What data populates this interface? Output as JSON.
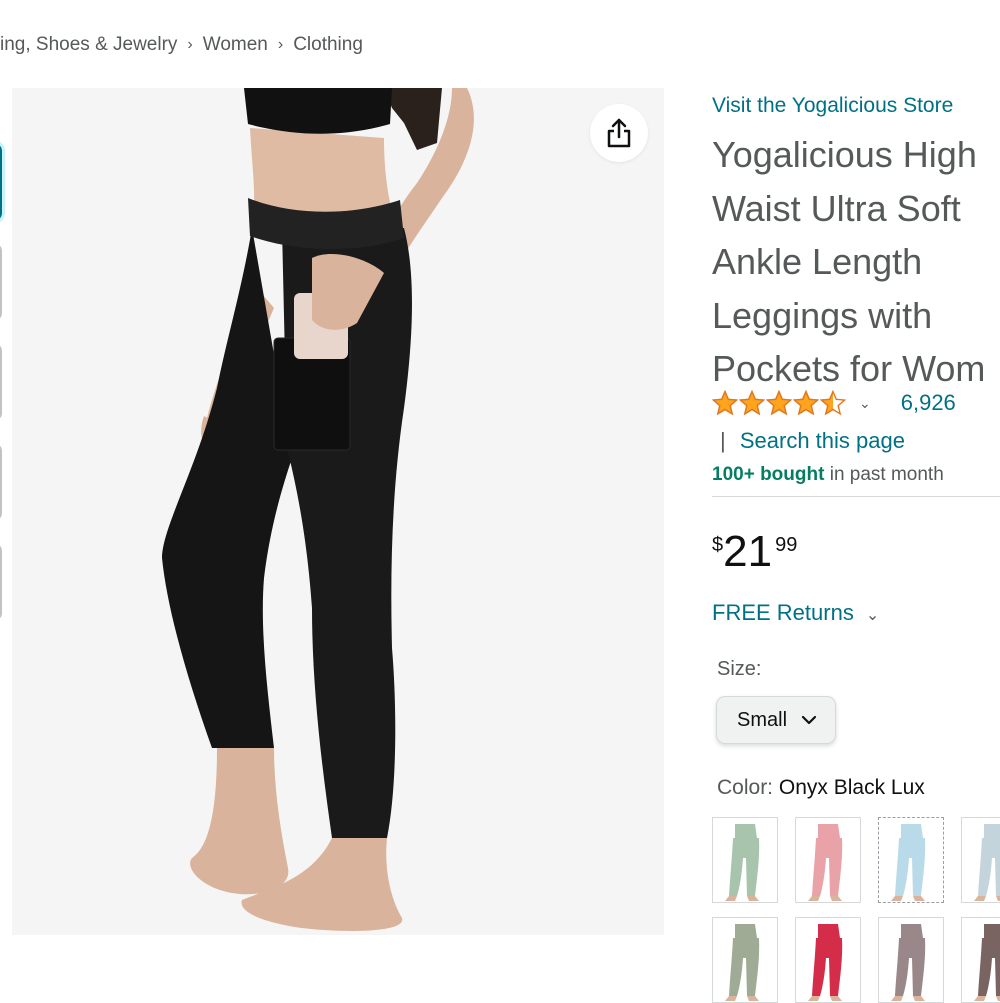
{
  "breadcrumb": {
    "items": [
      "ing, Shoes & Jewelry",
      "Women",
      "Clothing"
    ],
    "separator": "›"
  },
  "product": {
    "store_link": "Visit the Yogalicious Store",
    "title_lines": [
      "Yogalicious High",
      "Waist Ultra Soft",
      "Ankle Length",
      "Leggings with",
      "Pockets for Wom"
    ],
    "rating_count": "6,926",
    "search_bar": "|",
    "search_link": "Search this page",
    "bought_bold": "100+ bought",
    "bought_rest": " in past month",
    "price": {
      "symbol": "$",
      "whole": "21",
      "fraction": "99"
    },
    "free_returns": "FREE Returns",
    "size_label": "Size:",
    "size_value": "Small",
    "color_label": "Color:",
    "color_value": "Onyx Black Lux"
  },
  "rating": {
    "stars": 4.5,
    "max": 5
  },
  "icons": {
    "share": "share-icon",
    "star": "star-icon",
    "chevron": "chevron-down-icon"
  },
  "colors": {
    "link": "#007185",
    "star": "#ffa41c",
    "bought_bold": "#067d62",
    "swatch_colors": [
      "#a8c4ad",
      "#e8a2a8",
      "#b9dbe9",
      "#c4d4dc",
      "#a0ab96",
      "#d42d4a",
      "#9a8789",
      "#7a6461"
    ]
  }
}
